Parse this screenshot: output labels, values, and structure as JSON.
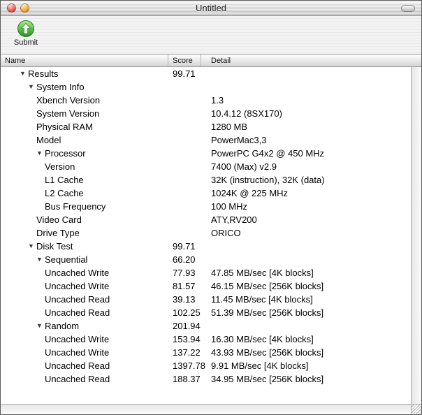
{
  "window": {
    "title": "Untitled"
  },
  "toolbar": {
    "submit_label": "Submit"
  },
  "icons": {
    "submit": "green-orb-up-arrow",
    "disclosure_glyph": "▼",
    "close": "red-circle",
    "minimize": "orange-circle",
    "toolbar_toggle": "pill",
    "resize_grip": "diagonal-lines"
  },
  "colors": {
    "submit_green": "#3f9e3b",
    "close_red": "#ec6157",
    "minimize_orange": "#f2a93c",
    "header_gradient_bottom": "#d4d4d4"
  },
  "table": {
    "columns": [
      "Name",
      "Score",
      "Detail"
    ],
    "rows": [
      {
        "level": 0,
        "disclosure": true,
        "name": "Results",
        "score": "99.71",
        "detail": ""
      },
      {
        "level": 1,
        "disclosure": true,
        "name": "System Info",
        "score": "",
        "detail": ""
      },
      {
        "level": 2,
        "disclosure": false,
        "name": "Xbench Version",
        "score": "",
        "detail": "1.3"
      },
      {
        "level": 2,
        "disclosure": false,
        "name": "System Version",
        "score": "",
        "detail": "10.4.12 (8SX170)"
      },
      {
        "level": 2,
        "disclosure": false,
        "name": "Physical RAM",
        "score": "",
        "detail": "1280 MB"
      },
      {
        "level": 2,
        "disclosure": false,
        "name": "Model",
        "score": "",
        "detail": "PowerMac3,3"
      },
      {
        "level": 2,
        "disclosure": true,
        "name": "Processor",
        "score": "",
        "detail": "PowerPC G4x2 @ 450 MHz"
      },
      {
        "level": 3,
        "disclosure": false,
        "name": "Version",
        "score": "",
        "detail": "7400 (Max) v2.9"
      },
      {
        "level": 3,
        "disclosure": false,
        "name": "L1 Cache",
        "score": "",
        "detail": "32K (instruction), 32K (data)"
      },
      {
        "level": 3,
        "disclosure": false,
        "name": "L2 Cache",
        "score": "",
        "detail": "1024K @ 225 MHz"
      },
      {
        "level": 3,
        "disclosure": false,
        "name": "Bus Frequency",
        "score": "",
        "detail": "100 MHz"
      },
      {
        "level": 2,
        "disclosure": false,
        "name": "Video Card",
        "score": "",
        "detail": "ATY,RV200"
      },
      {
        "level": 2,
        "disclosure": false,
        "name": "Drive Type",
        "score": "",
        "detail": "ORICO"
      },
      {
        "level": 1,
        "disclosure": true,
        "name": "Disk Test",
        "score": "99.71",
        "detail": ""
      },
      {
        "level": 2,
        "disclosure": true,
        "name": "Sequential",
        "score": "66.20",
        "detail": ""
      },
      {
        "level": 3,
        "disclosure": false,
        "name": "Uncached Write",
        "score": "77.93",
        "detail": "47.85 MB/sec [4K blocks]"
      },
      {
        "level": 3,
        "disclosure": false,
        "name": "Uncached Write",
        "score": "81.57",
        "detail": "46.15 MB/sec [256K blocks]"
      },
      {
        "level": 3,
        "disclosure": false,
        "name": "Uncached Read",
        "score": "39.13",
        "detail": "11.45 MB/sec [4K blocks]"
      },
      {
        "level": 3,
        "disclosure": false,
        "name": "Uncached Read",
        "score": "102.25",
        "detail": "51.39 MB/sec [256K blocks]"
      },
      {
        "level": 2,
        "disclosure": true,
        "name": "Random",
        "score": "201.94",
        "detail": ""
      },
      {
        "level": 3,
        "disclosure": false,
        "name": "Uncached Write",
        "score": "153.94",
        "detail": "16.30 MB/sec [4K blocks]"
      },
      {
        "level": 3,
        "disclosure": false,
        "name": "Uncached Write",
        "score": "137.22",
        "detail": "43.93 MB/sec [256K blocks]"
      },
      {
        "level": 3,
        "disclosure": false,
        "name": "Uncached Read",
        "score": "1397.78",
        "detail": "9.91 MB/sec [4K blocks]"
      },
      {
        "level": 3,
        "disclosure": false,
        "name": "Uncached Read",
        "score": "188.37",
        "detail": "34.95 MB/sec [256K blocks]"
      }
    ]
  }
}
